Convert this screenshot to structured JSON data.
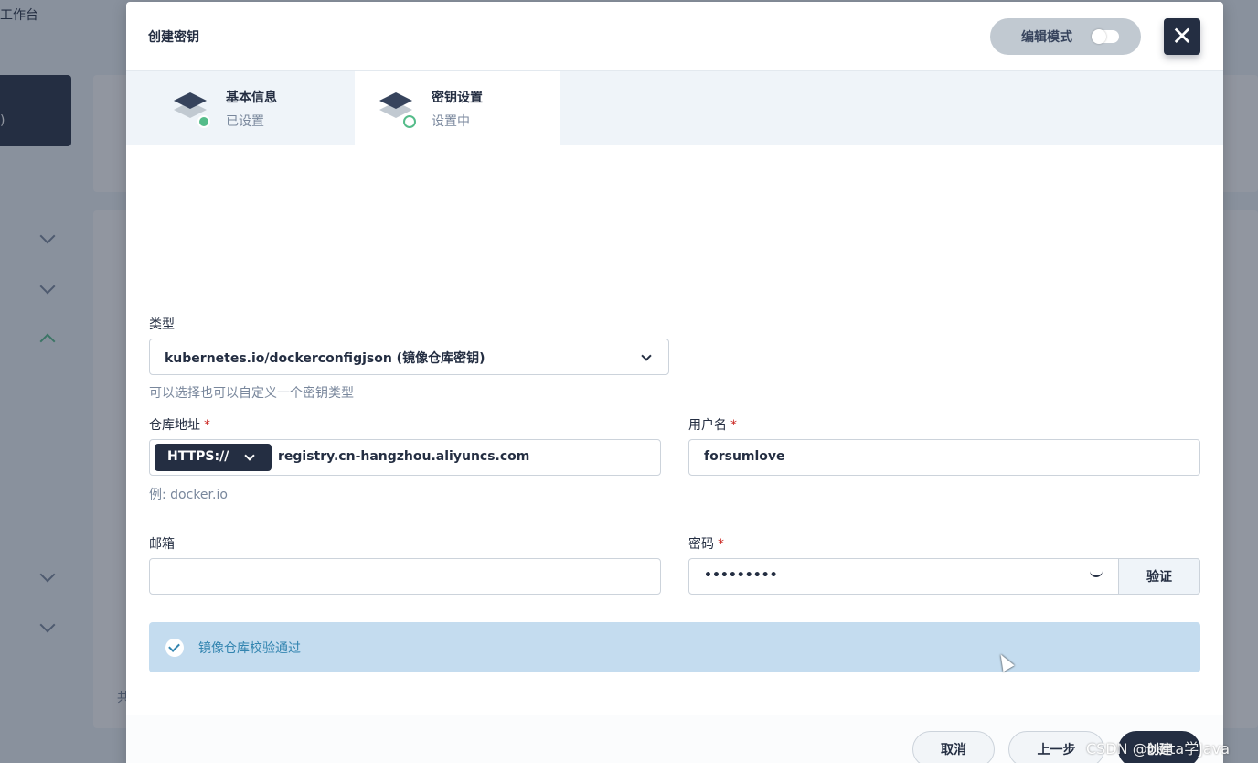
{
  "background": {
    "workspace_title": "工作台",
    "nav_selected_label": ")",
    "footer_fragment": "共"
  },
  "modal": {
    "title": "创建密钥",
    "edit_mode_label": "编辑模式",
    "close_icon": "close-icon"
  },
  "steps": [
    {
      "title": "基本信息",
      "status": "已设置"
    },
    {
      "title": "密钥设置",
      "status": "设置中"
    }
  ],
  "form": {
    "type_label": "类型",
    "type_value": "kubernetes.io/dockerconfigjson (镜像仓库密钥)",
    "type_hint": "可以选择也可以自定义一个密钥类型",
    "registry_label": "仓库地址",
    "registry_protocol": "HTTPS://",
    "registry_value": "registry.cn-hangzhou.aliyuncs.com",
    "registry_hint": "例: docker.io",
    "username_label": "用户名",
    "username_value": "forsumlove",
    "email_label": "邮箱",
    "email_value": "",
    "password_label": "密码",
    "password_value": "•••••••••",
    "verify_label": "验证",
    "required_mark": "*"
  },
  "alert": {
    "message": "镜像仓库校验通过"
  },
  "footer": {
    "cancel_label": "取消",
    "prev_label": "上一步",
    "create_label": "创建"
  },
  "watermark": "CSDN @beita学Java",
  "colors": {
    "primary": "#242e42",
    "success": "#55bc8a",
    "required": "#ca2621",
    "alert_bg": "#c4dcef",
    "alert_text": "#3385b0"
  }
}
